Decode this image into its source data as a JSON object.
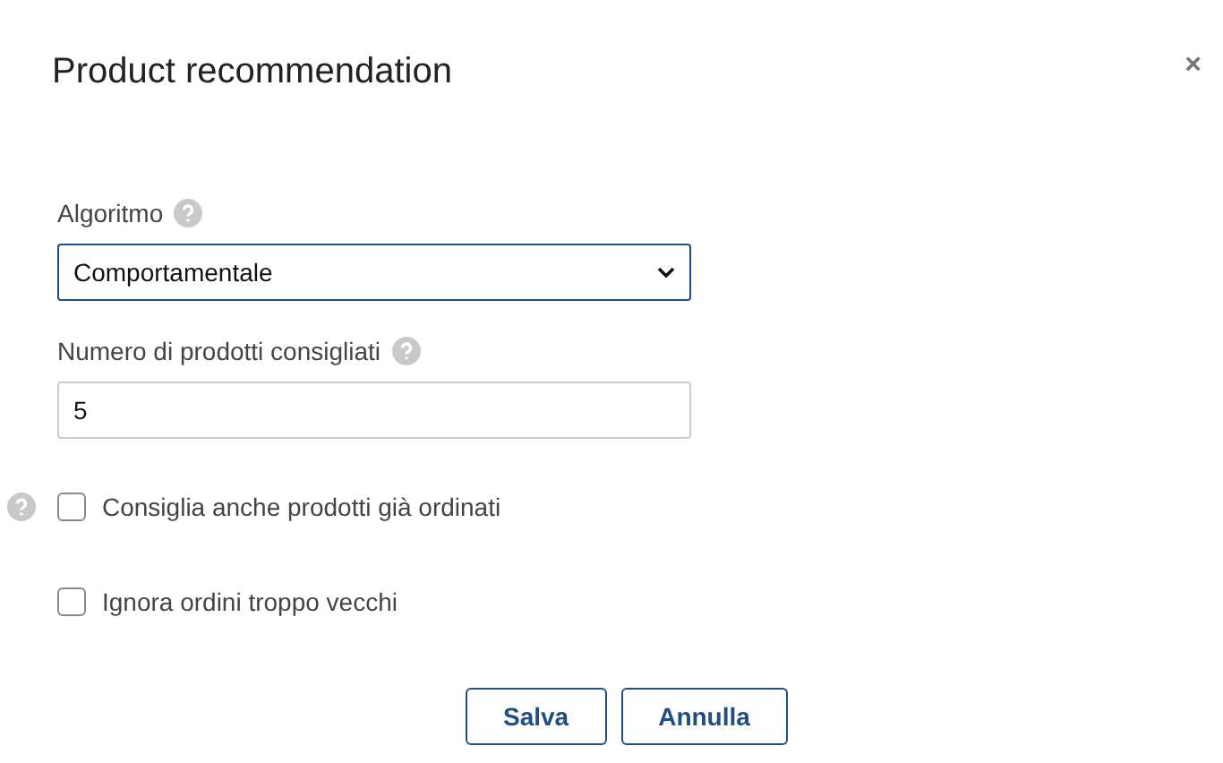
{
  "dialog": {
    "title": "Product recommendation",
    "close": "×"
  },
  "fields": [
    {
      "kind": "select",
      "label": "Algoritmo",
      "help": true,
      "value": "Comportamentale"
    },
    {
      "kind": "text",
      "label": "Numero di prodotti consigliati",
      "help": true,
      "value": "5"
    },
    {
      "kind": "checkbox",
      "label": "Consiglia anche prodotti già ordinati",
      "help": true,
      "checked": false
    },
    {
      "kind": "checkbox",
      "label": "Ignora ordini troppo vecchi",
      "help": false,
      "checked": false
    }
  ],
  "buttons": [
    "Salva",
    "Annulla"
  ]
}
